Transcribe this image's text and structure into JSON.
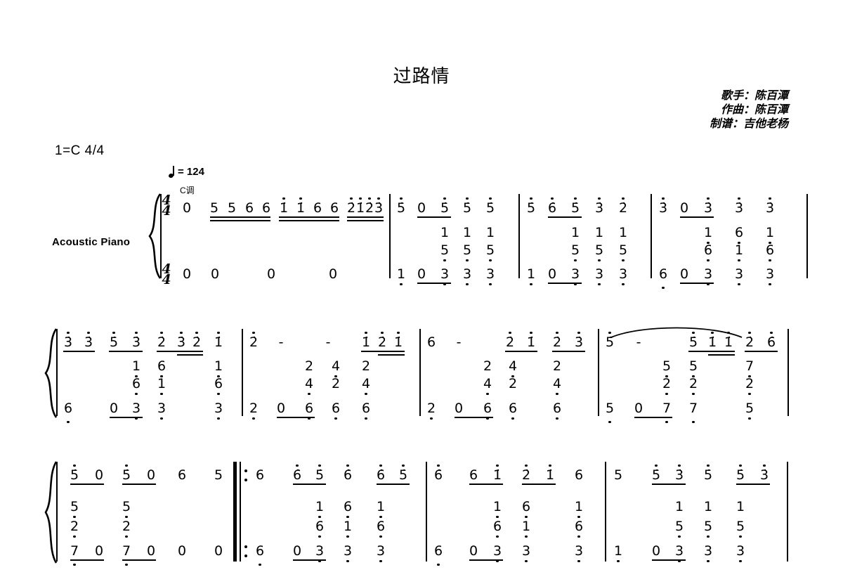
{
  "title": "过路情",
  "credits": [
    "歌手：陈百潭",
    "作曲：陈百潭",
    "制谱：吉他老杨"
  ],
  "key_signature": "1=C 4/4",
  "tempo": {
    "note_icon": "quarter-note-icon",
    "equals": "= 124",
    "tonality": "C调"
  },
  "instrument": "Acoustic Piano",
  "time_signature": {
    "numerator": "4",
    "denominator": "4"
  },
  "notation_system": "jianpu",
  "score": {
    "systems": [
      {
        "index": 1,
        "measures": [
          {
            "number": 1,
            "upper": [
              "0",
              "5",
              "5",
              "6",
              "6",
              "1̇",
              "1̇",
              "6",
              "6",
              "2̇",
              "1̇",
              "2̇",
              "3̇"
            ],
            "middle_upper": [],
            "middle_lower": [],
            "bass": [
              "0",
              "0",
              "0",
              "0"
            ]
          },
          {
            "number": 2,
            "upper": [
              "5̇",
              "0",
              "5̇",
              "5̇",
              "5̇"
            ],
            "middle_upper": [
              "1",
              "1",
              "1"
            ],
            "middle_lower": [
              "5",
              "5",
              "5"
            ],
            "bass": [
              "1",
              "0",
              "3",
              "3",
              "3"
            ]
          },
          {
            "number": 3,
            "upper": [
              "5̇",
              "6̇",
              "5̇",
              "3̇",
              "2̇"
            ],
            "middle_upper": [
              "1",
              "1",
              "1"
            ],
            "middle_lower": [
              "5",
              "5",
              "5"
            ],
            "bass": [
              "1",
              "0",
              "3",
              "3",
              "3"
            ]
          },
          {
            "number": 4,
            "upper": [
              "3̇",
              "0",
              "3̇",
              "3̇",
              "3̇"
            ],
            "middle_upper": [
              "1",
              "6",
              "1"
            ],
            "middle_lower": [
              "6",
              "1",
              "6"
            ],
            "bass": [
              "6",
              "0",
              "3",
              "3",
              "3"
            ]
          }
        ]
      },
      {
        "index": 2,
        "measures": [
          {
            "number": 5,
            "upper": [
              "3̇",
              "3̇",
              "5̇",
              "3̇",
              "2̇",
              "3̇",
              "2̇",
              "1̇"
            ],
            "middle_upper": [
              "1",
              "6",
              "1"
            ],
            "middle_lower": [
              "6",
              "1",
              "6"
            ],
            "bass": [
              "6",
              "0",
              "3",
              "3",
              "3"
            ]
          },
          {
            "number": 6,
            "upper": [
              "2̇",
              "-",
              "-",
              "1̇",
              "2̇",
              "1̇"
            ],
            "middle_upper": [
              "2",
              "4",
              "2"
            ],
            "middle_lower": [
              "4",
              "2",
              "4"
            ],
            "bass": [
              "2",
              "0",
              "6",
              "6",
              "6"
            ]
          },
          {
            "number": 7,
            "upper": [
              "6",
              "-",
              "2̇",
              "1̇",
              "2̇",
              "3̇"
            ],
            "middle_upper": [
              "2",
              "4",
              "2"
            ],
            "middle_lower": [
              "4",
              "2",
              "4"
            ],
            "bass": [
              "2",
              "0",
              "6",
              "6",
              "6"
            ]
          },
          {
            "number": 8,
            "upper": [
              "5̇",
              "-",
              "5̇",
              "1̇",
              "1̇",
              "2̇",
              "6̇"
            ],
            "middle_upper": [
              "5",
              "5",
              "7"
            ],
            "middle_lower": [
              "2",
              "2",
              "2"
            ],
            "bass": [
              "5",
              "0",
              "7",
              "7",
              "5"
            ],
            "slur": true
          }
        ]
      },
      {
        "index": 3,
        "measures": [
          {
            "number": 9,
            "upper": [
              "5̇",
              "0",
              "5̇",
              "0",
              "6",
              "5"
            ],
            "middle_upper": [
              "5",
              "5"
            ],
            "middle_lower": [
              "2",
              "2"
            ],
            "bass": [
              "7",
              "0",
              "7",
              "0",
              "0",
              "0"
            ]
          },
          {
            "number": 10,
            "repeat_start": true,
            "upper": [
              "6",
              "6̇",
              "5̇",
              "6̇",
              "6̇",
              "5̇"
            ],
            "middle_upper": [
              "1",
              "6",
              "1"
            ],
            "middle_lower": [
              "6",
              "1",
              "6"
            ],
            "bass": [
              "6",
              "0",
              "3",
              "3",
              "3"
            ]
          },
          {
            "number": 11,
            "upper": [
              "6̇",
              "6",
              "1̇",
              "2̇",
              "1̇",
              "6"
            ],
            "middle_upper": [
              "1",
              "6",
              "1"
            ],
            "middle_lower": [
              "6",
              "1",
              "6"
            ],
            "bass": [
              "6",
              "0",
              "3",
              "3",
              "3"
            ]
          },
          {
            "number": 12,
            "upper": [
              "5",
              "5̇",
              "3̇",
              "5̇",
              "5̇",
              "3̇"
            ],
            "middle_upper": [
              "1",
              "1",
              "1"
            ],
            "middle_lower": [
              "5",
              "5",
              "5"
            ],
            "bass": [
              "1",
              "0",
              "3",
              "3",
              "3"
            ]
          }
        ]
      }
    ]
  },
  "glyphs": {
    "zero": "0",
    "dash": "-",
    "one": "1",
    "two": "2",
    "three": "3",
    "four": "4",
    "five": "5",
    "six": "6",
    "seven": "7"
  }
}
